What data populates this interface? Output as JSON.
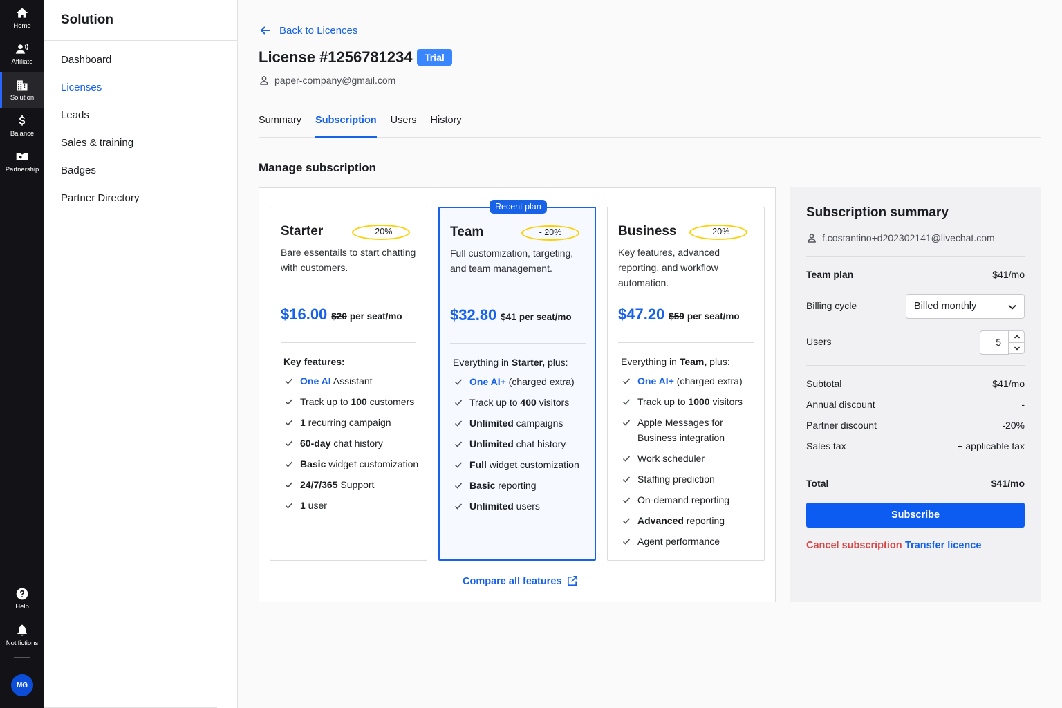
{
  "rail": {
    "items": [
      {
        "label": "Home",
        "icon": "home-icon"
      },
      {
        "label": "Affiliate",
        "icon": "affiliate-icon"
      },
      {
        "label": "Solution",
        "icon": "building-icon"
      },
      {
        "label": "Balance",
        "icon": "dollar-icon"
      },
      {
        "label": "Partnership",
        "icon": "partnership-icon"
      }
    ],
    "bottom": [
      {
        "label": "Help",
        "icon": "help-icon"
      },
      {
        "label": "Notifictions",
        "icon": "bell-icon"
      }
    ],
    "avatar": "MG",
    "accent": "#2965ff"
  },
  "subnav": {
    "title": "Solution",
    "items": [
      "Dashboard",
      "Licenses",
      "Leads",
      "Sales & training",
      "Badges",
      "Partner Directory"
    ],
    "active": "Licenses"
  },
  "header": {
    "back": "Back to Licences",
    "title": "License #1256781234",
    "badge": "Trial",
    "owner": "paper-company@gmail.com"
  },
  "tabs": [
    "Summary",
    "Subscription",
    "Users",
    "History"
  ],
  "active_tab": "Subscription",
  "manage": {
    "title": "Manage subscription",
    "recent_label": "Recent plan",
    "compare": "Compare all features",
    "plans": [
      {
        "name": "Starter",
        "discount": "- 20%",
        "desc": "Bare essentails to start chatting with customers.",
        "price": "$16.00",
        "old": "$20",
        "per": "per seat/mo",
        "feat_head": "Key features:",
        "features": [
          {
            "parts": [
              {
                "t": "One AI",
                "s": "blue"
              },
              {
                "t": " Assistant",
                "s": ""
              }
            ]
          },
          {
            "parts": [
              {
                "t": "Track up to ",
                "s": ""
              },
              {
                "t": "100",
                "s": "b"
              },
              {
                "t": " customers",
                "s": ""
              }
            ]
          },
          {
            "parts": [
              {
                "t": "1",
                "s": "b"
              },
              {
                "t": " recurring campaign",
                "s": ""
              }
            ]
          },
          {
            "parts": [
              {
                "t": "60-day",
                "s": "b"
              },
              {
                "t": " chat history",
                "s": ""
              }
            ]
          },
          {
            "parts": [
              {
                "t": "Basic",
                "s": "b"
              },
              {
                "t": " widget customization",
                "s": ""
              }
            ]
          },
          {
            "parts": [
              {
                "t": "24/7/365",
                "s": "b"
              },
              {
                "t": " Support",
                "s": ""
              }
            ]
          },
          {
            "parts": [
              {
                "t": "1",
                "s": "b"
              },
              {
                "t": " user",
                "s": ""
              }
            ]
          }
        ]
      },
      {
        "name": "Team",
        "discount": "- 20%",
        "desc": "Full customization, targeting, and team management.",
        "price": "$32.80",
        "old": "$41",
        "per": "per seat/mo",
        "feat_head_parts": [
          {
            "t": "Everything in ",
            "s": ""
          },
          {
            "t": "Starter,",
            "s": "b"
          },
          {
            "t": " plus:",
            "s": ""
          }
        ],
        "features": [
          {
            "parts": [
              {
                "t": "One AI+",
                "s": "blue"
              },
              {
                "t": " (charged extra)",
                "s": ""
              }
            ]
          },
          {
            "parts": [
              {
                "t": "Track up to ",
                "s": ""
              },
              {
                "t": "400",
                "s": "b"
              },
              {
                "t": " visitors",
                "s": ""
              }
            ]
          },
          {
            "parts": [
              {
                "t": "Unlimited",
                "s": "b"
              },
              {
                "t": " campaigns",
                "s": ""
              }
            ]
          },
          {
            "parts": [
              {
                "t": "Unlimited",
                "s": "b"
              },
              {
                "t": " chat history",
                "s": ""
              }
            ]
          },
          {
            "parts": [
              {
                "t": "Full",
                "s": "b"
              },
              {
                "t": " widget customization",
                "s": ""
              }
            ]
          },
          {
            "parts": [
              {
                "t": "Basic",
                "s": "b"
              },
              {
                "t": " reporting",
                "s": ""
              }
            ]
          },
          {
            "parts": [
              {
                "t": "Unlimited",
                "s": "b"
              },
              {
                "t": " users",
                "s": ""
              }
            ]
          }
        ]
      },
      {
        "name": "Business",
        "discount": "- 20%",
        "desc": "Key features, advanced reporting, and workflow automation.",
        "price": "$47.20",
        "old": "$59",
        "per": "per seat/mo",
        "feat_head_parts": [
          {
            "t": "Everything in ",
            "s": ""
          },
          {
            "t": "Team,",
            "s": "b"
          },
          {
            "t": " plus:",
            "s": ""
          }
        ],
        "features": [
          {
            "parts": [
              {
                "t": "One AI+",
                "s": "blue"
              },
              {
                "t": " (charged extra)",
                "s": ""
              }
            ]
          },
          {
            "parts": [
              {
                "t": "Track up to ",
                "s": ""
              },
              {
                "t": "1000",
                "s": "b"
              },
              {
                "t": " visitors",
                "s": ""
              }
            ]
          },
          {
            "parts": [
              {
                "t": "Apple Messages for Business integration",
                "s": ""
              }
            ]
          },
          {
            "parts": [
              {
                "t": "Work scheduler",
                "s": ""
              }
            ]
          },
          {
            "parts": [
              {
                "t": "Staffing prediction",
                "s": ""
              }
            ]
          },
          {
            "parts": [
              {
                "t": "On-demand reporting",
                "s": ""
              }
            ]
          },
          {
            "parts": [
              {
                "t": "Advanced",
                "s": "b"
              },
              {
                "t": " reporting",
                "s": ""
              }
            ]
          },
          {
            "parts": [
              {
                "t": "Agent performance",
                "s": ""
              }
            ]
          }
        ]
      }
    ]
  },
  "summary": {
    "title": "Subscription summary",
    "email": "f.costantino+d202302141@livechat.com",
    "plan_label": "Team plan",
    "plan_value": "$41/mo",
    "billing_label": "Billing cycle",
    "billing_value": "Billed monthly",
    "users_label": "Users",
    "users_value": "5",
    "subtotal_label": "Subtotal",
    "subtotal_value": "$41/mo",
    "annual_label": "Annual discount",
    "annual_value": "-",
    "partner_label": "Partner discount",
    "partner_value": "-20%",
    "tax_label": "Sales tax",
    "tax_value": "+ applicable tax",
    "total_label": "Total",
    "total_value": "$41/mo",
    "subscribe": "Subscribe",
    "cancel": "Cancel subscription",
    "transfer": "Transfer licence"
  }
}
